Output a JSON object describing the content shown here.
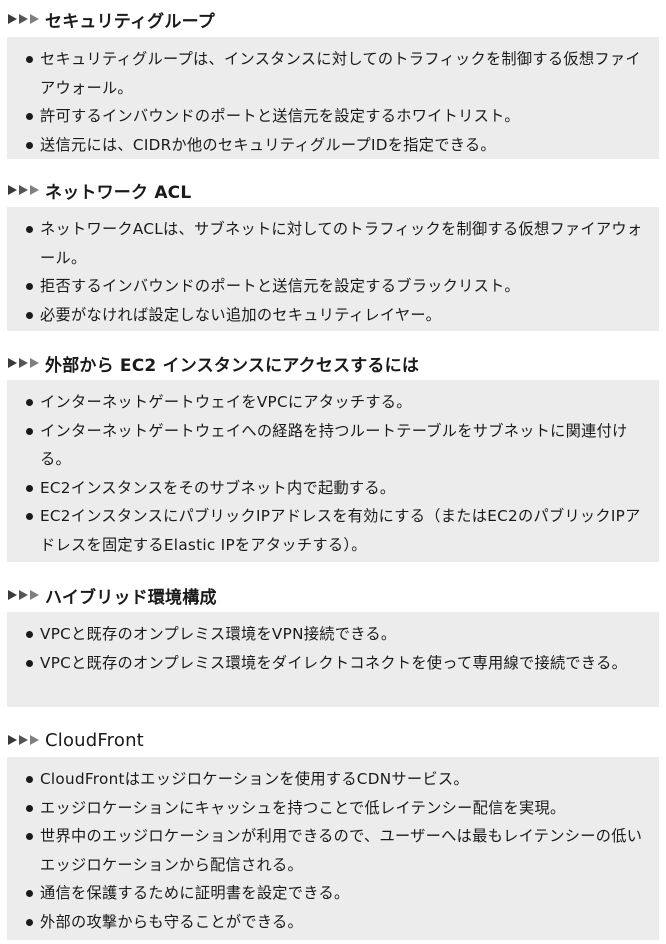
{
  "sections": [
    {
      "title": "セキュリティグループ",
      "items": [
        "セキュリティグループは、インスタンスに対してのトラフィックを制御する仮想ファイアウォール。",
        "許可するインバウンドのポートと送信元を設定するホワイトリスト。",
        "送信元には、CIDRか他のセキュリティグループIDを指定できる。"
      ]
    },
    {
      "title": "ネットワーク ACL",
      "items": [
        "ネットワークACLは、サブネットに対してのトラフィックを制御する仮想ファイアウォール。",
        "拒否するインバウンドのポートと送信元を設定するブラックリスト。",
        "必要がなければ設定しない追加のセキュリティレイヤー。"
      ]
    },
    {
      "title": "外部から EC2 インスタンスにアクセスするには",
      "items": [
        "インターネットゲートウェイをVPCにアタッチする。",
        "インターネットゲートウェイへの経路を持つルートテーブルをサブネットに関連付ける。",
        "EC2インスタンスをそのサブネット内で起動する。",
        "EC2インスタンスにパブリックIPアドレスを有効にする（またはEC2のパブリックIPアドレスを固定するElastic IPをアタッチする）。"
      ]
    },
    {
      "title": "ハイブリッド環境構成",
      "items": [
        "VPCと既存のオンプレミス環境をVPN接続できる。",
        "VPCと既存のオンプレミス環境をダイレクトコネクトを使って専用線で接続できる。"
      ]
    },
    {
      "title": "CloudFront",
      "items": [
        "CloudFrontはエッジロケーションを使用するCDNサービス。",
        "エッジロケーションにキャッシュを持つことで低レイテンシー配信を実現。",
        "世界中のエッジロケーションが利用できるので、ユーザーへは最もレイテンシーの低いエッジロケーションから配信される。",
        "通信を保護するために証明書を設定できる。",
        "外部の攻撃からも守ることができる。"
      ]
    }
  ]
}
